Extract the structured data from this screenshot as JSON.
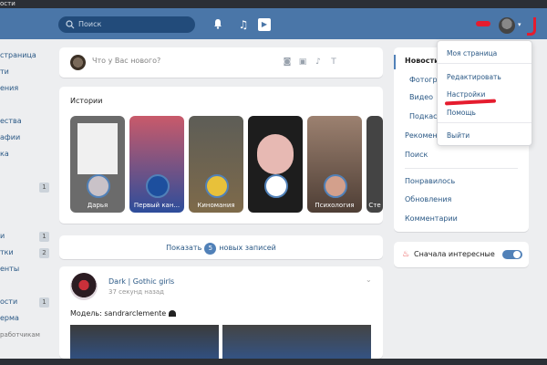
{
  "window": {
    "title": "ости"
  },
  "topbar": {
    "search_placeholder": "Поиск",
    "icons": [
      "bell-icon",
      "music-icon",
      "play-icon"
    ]
  },
  "left_nav": {
    "items": [
      {
        "label": "страница",
        "badge": ""
      },
      {
        "label": "ти",
        "badge": ""
      },
      {
        "label": "ения",
        "badge": ""
      },
      {
        "label": "",
        "badge": ""
      },
      {
        "label": "ества",
        "badge": ""
      },
      {
        "label": "афии",
        "badge": ""
      },
      {
        "label": "ка",
        "badge": ""
      },
      {
        "label": "",
        "badge": ""
      },
      {
        "label": "",
        "badge": "1"
      },
      {
        "label": "",
        "badge": ""
      },
      {
        "label": "",
        "badge": ""
      },
      {
        "label": "и",
        "badge": "1"
      },
      {
        "label": "тки",
        "badge": "2"
      },
      {
        "label": "енты",
        "badge": ""
      },
      {
        "label": "",
        "badge": ""
      },
      {
        "label": "ости",
        "badge": "1"
      },
      {
        "label": "ерма",
        "badge": ""
      }
    ],
    "footer": "работчикам"
  },
  "composer": {
    "placeholder": "Что у Вас нового?"
  },
  "stories": {
    "title": "Истории",
    "items": [
      {
        "label": "Дарья"
      },
      {
        "label": "Первый кан..."
      },
      {
        "label": "Киномания"
      },
      {
        "label": ""
      },
      {
        "label": "Психология"
      },
      {
        "label": "Сте"
      }
    ]
  },
  "new_posts": {
    "prefix": "Показать",
    "count": "5",
    "suffix": "новых записей"
  },
  "post": {
    "author": "Dark | Gothic girls",
    "time": "37 секунд назад",
    "text": "Модель: sandrarclemente"
  },
  "right_menu": {
    "items": [
      "Новости",
      "Фотогр",
      "Видео",
      "Подкаст",
      "Рекомен",
      "Поиск",
      "Понравилось",
      "Обновления",
      "Комментарии"
    ]
  },
  "toggle": {
    "label": "Сначала интересные"
  },
  "dropdown": {
    "items": [
      "Моя страница",
      "Редактировать",
      "Настройки",
      "Помощь",
      "Выйти"
    ]
  },
  "colors": {
    "brand": "#4a76a8",
    "link": "#2a5885",
    "annotation": "#e51c2e"
  }
}
